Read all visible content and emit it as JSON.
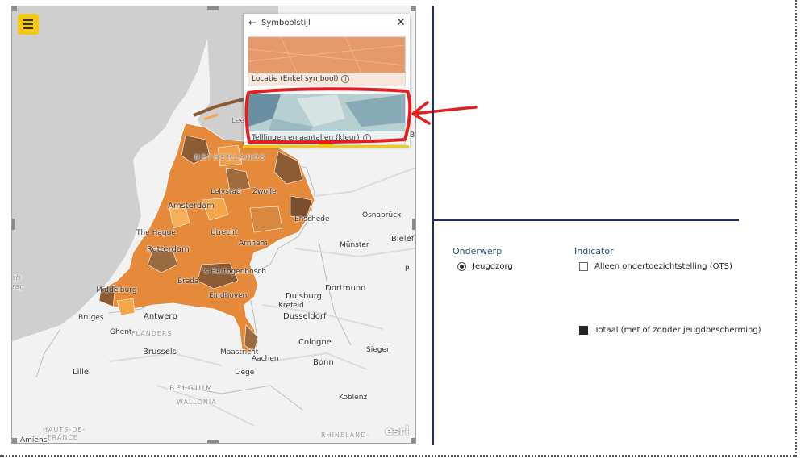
{
  "map": {
    "menu_icon": "hamburger-menu-icon",
    "labels": {
      "netherlands": "NETHERLANDS",
      "lelystad": "Lelystad",
      "zwolle": "Zwolle",
      "amsterdam": "Amsterdam",
      "the_hague": "The Hague",
      "rotterdam": "Rotterdam",
      "utrecht": "Utrecht",
      "arnhem": "Arnhem",
      "enschede": "Enschede",
      "osnabruck": "Osnabrück",
      "bielefeld": "Bielefe",
      "munster": "Münster",
      "middelburg": "Middelburg",
      "s_hertogenbosch": "'s-Hertogenbosch",
      "breda": "Breda",
      "eindhoven": "Eindhoven",
      "dortmund": "Dortmund",
      "duisburg": "Duisburg",
      "krefeld": "Krefeld",
      "dusseldorf": "Dusseldorf",
      "antwerp": "Antwerp",
      "bruges": "Bruges",
      "ghent": "Ghent",
      "flanders": "FLANDERS",
      "brussels": "Brussels",
      "maastricht": "Maastricht",
      "aachen": "Aachen",
      "cologne": "Cologne",
      "bonn": "Bonn",
      "siegen": "Siegen",
      "liege": "Liège",
      "lille": "Lille",
      "belgium": "BELGIUM",
      "wallonia": "WALLONIA",
      "koblenz": "Koblenz",
      "hauts_de_france": "HAUTS-DE-",
      "france": "FRANCE",
      "amiens": "Amiens",
      "rhineland": "RHINELAND-",
      "sh": "sh",
      "frag": "rag",
      "b": "B",
      "p": "P",
      "leeuw": "Leeuw"
    },
    "attribution": "esri",
    "colors": {
      "sea": "#cdcdcd",
      "land": "#f2f2f2",
      "municipality_light": "#f5a54a",
      "municipality_mid": "#e07b2f",
      "municipality_dark": "#8c5a33"
    }
  },
  "symbol_panel": {
    "back_icon": "arrow-left-icon",
    "title": "Symboolstijl",
    "close_icon": "close-icon",
    "options": [
      {
        "label": "Locatie (Enkel symbool)",
        "info": "i"
      },
      {
        "label": "Telllingen en aantallen (kleur)",
        "info": "i"
      }
    ],
    "collapse_icon": "chevron-up-icon"
  },
  "slicers": {
    "onderwerp": {
      "title": "Onderwerp",
      "options": [
        {
          "label": "Jeugdzorg",
          "selected": true
        }
      ]
    },
    "indicator": {
      "title": "Indicator",
      "options": [
        {
          "label": "Alleen ondertoezichtstelling (OTS)",
          "checked": false
        },
        {
          "label": "Totaal (met of zonder jeugdbescherming)",
          "checked": true
        }
      ]
    }
  },
  "annotation": {
    "color": "#e41e1e"
  }
}
